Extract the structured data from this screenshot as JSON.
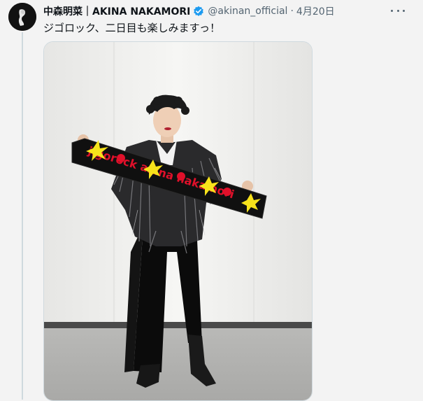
{
  "tweet": {
    "author_name": "中森明菜｜AKINA NAKAMORI",
    "handle": "@akinan_official",
    "separator": "·",
    "date": "4月20日",
    "text": "ジゴロック、二日目も楽しみますっ！",
    "verified_icon": "verified-badge-icon",
    "more_icon": "more-options-icon",
    "media": {
      "towel_text": "jigorock akina nakamori",
      "colors": {
        "towel": "#101010",
        "towel_text": "#e0102a",
        "accent": "#f7e21b"
      }
    }
  }
}
